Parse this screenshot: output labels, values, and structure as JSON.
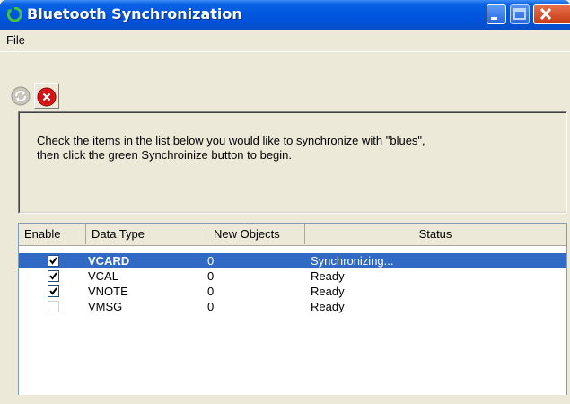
{
  "window": {
    "title": "Bluetooth Synchronization"
  },
  "menu": {
    "file": "File"
  },
  "toolbar": {
    "sync_icon": "sync-icon",
    "stop_icon": "stop-icon"
  },
  "info": {
    "line1": "Check the items in the list below you would like to synchronize with \"blues\",",
    "line2": "then click the green Synchroinize button to begin."
  },
  "table": {
    "headers": {
      "enable": "Enable",
      "data_type": "Data Type",
      "new_objects": "New Objects",
      "status": "Status"
    },
    "rows": [
      {
        "enabled": true,
        "data_type": "VCARD",
        "new_objects": "0",
        "status": "Synchronizing...",
        "selected": true
      },
      {
        "enabled": true,
        "data_type": "VCAL",
        "new_objects": "0",
        "status": "Ready",
        "selected": false
      },
      {
        "enabled": true,
        "data_type": "VNOTE",
        "new_objects": "0",
        "status": "Ready",
        "selected": false
      },
      {
        "enabled": false,
        "data_type": "VMSG",
        "new_objects": "0",
        "status": "Ready",
        "selected": false
      }
    ]
  },
  "colors": {
    "titlebar": "#0058e0",
    "selection": "#316ac5",
    "window_bg": "#ece9d8"
  }
}
